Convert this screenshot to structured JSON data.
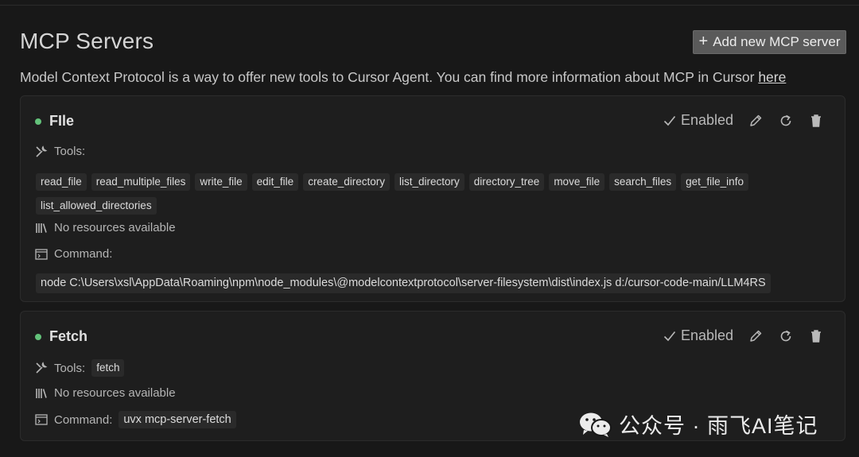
{
  "header": {
    "title": "MCP Servers",
    "add_button_label": "Add new MCP server",
    "description": "Model Context Protocol is a way to offer new tools to Cursor Agent. You can find more information about MCP in Cursor ",
    "description_link": "here"
  },
  "servers": [
    {
      "name": "FIle",
      "status_color": "#63c27a",
      "enabled_label": "Enabled",
      "tools_label": "Tools:",
      "tools": [
        "read_file",
        "read_multiple_files",
        "write_file",
        "edit_file",
        "create_directory",
        "list_directory",
        "directory_tree",
        "move_file",
        "search_files",
        "get_file_info",
        "list_allowed_directories"
      ],
      "resources_label": "No resources available",
      "command_label": "Command:",
      "command": "node C:\\Users\\xsl\\AppData\\Roaming\\npm\\node_modules\\@modelcontextprotocol\\server-filesystem\\dist\\index.js d:/cursor-code-main/LLM4RS"
    },
    {
      "name": "Fetch",
      "status_color": "#63c27a",
      "enabled_label": "Enabled",
      "tools_label": "Tools:",
      "tools": [
        "fetch"
      ],
      "resources_label": "No resources available",
      "command_label": "Command:",
      "command": "uvx mcp-server-fetch"
    }
  ],
  "watermark": {
    "text": "公众号 · 雨飞AI笔记",
    "icon": "wechat-icon"
  },
  "colors": {
    "background": "#181818",
    "card": "#1e1e1e",
    "chip": "#2a2a2a",
    "status_green": "#63c27a",
    "button": "#5a5a5a"
  }
}
